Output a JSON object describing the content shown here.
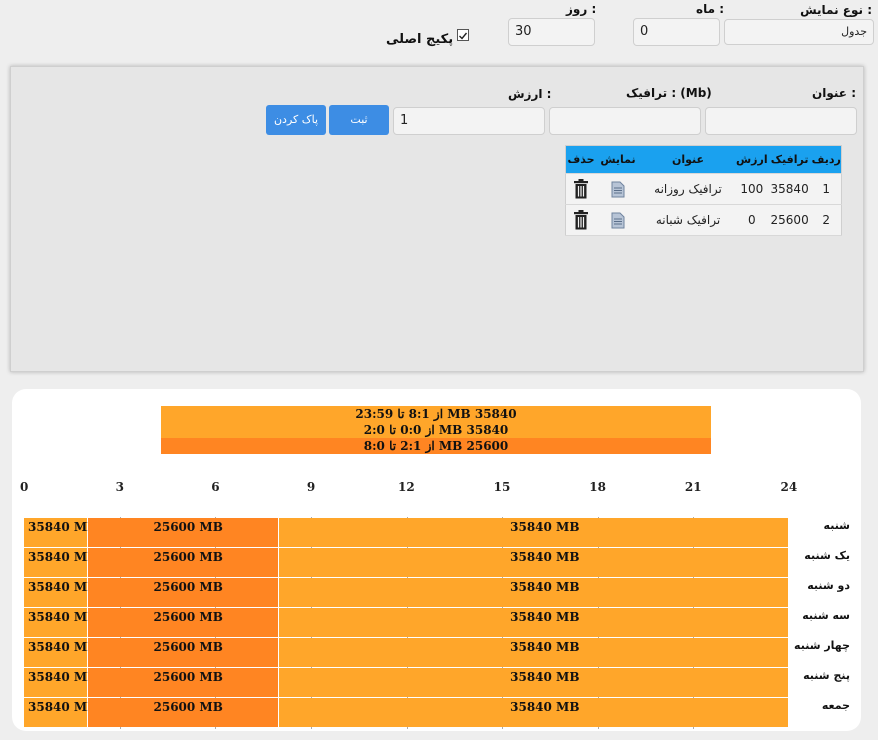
{
  "top": {
    "display_type_label": "نوع نمایش :",
    "display_type_value": "جدول",
    "month_label": "ماه :",
    "month_value": "0",
    "day_label": "روز :",
    "day_value": "30",
    "main_package_label": "پکیج اصلی",
    "main_package_checked": true
  },
  "form": {
    "title_label": "عنوان :",
    "traffic_label": "ترافیک : (Mb)",
    "value_label": "ارزش :",
    "title_value": "",
    "traffic_value": "",
    "value_value": "1",
    "submit_label": "ثبت",
    "clear_label": "پاک کردن"
  },
  "table": {
    "headers": [
      "ردیف",
      "ترافیک",
      "ارزش",
      "عنوان",
      "نمایش",
      "حذف"
    ],
    "rows": [
      {
        "row": "1",
        "traffic": "35840",
        "value": "100",
        "title": "ترافیک روزانه"
      },
      {
        "row": "2",
        "traffic": "25600",
        "value": "0",
        "title": "ترافیک شبانه"
      }
    ]
  },
  "legend": [
    {
      "text": "35840 MB از 8:1 تا 23:59",
      "color": "#ffa62a"
    },
    {
      "text": "35840 MB از 0:0 تا 2:0",
      "color": "#ffa62a"
    },
    {
      "text": "25600 MB از 2:1 تا 8:0",
      "color": "#ff8522"
    }
  ],
  "chart_data": {
    "type": "timeline",
    "x_ticks": [
      "0",
      "3",
      "6",
      "9",
      "12",
      "15",
      "18",
      "21",
      "24"
    ],
    "xlim": [
      0,
      24
    ],
    "days": [
      "شنبه",
      "یک شنبه",
      "دو شنبه",
      "سه شنبه",
      "چهار شنبه",
      "پنج شنبه",
      "جمعه"
    ],
    "segments": [
      {
        "start": 0,
        "end": 2,
        "label": "35840 MB",
        "color": "#ffa62a"
      },
      {
        "start": 2,
        "end": 8,
        "label": "25600 MB",
        "color": "#ff8522"
      },
      {
        "start": 8,
        "end": 24,
        "label": "35840 MB",
        "color": "#ffa62a"
      }
    ]
  },
  "colors": {
    "accent_button": "#3d8de4",
    "table_header": "#1aa1ef",
    "day_traffic": "#ffa62a",
    "night_traffic": "#ff8522"
  }
}
